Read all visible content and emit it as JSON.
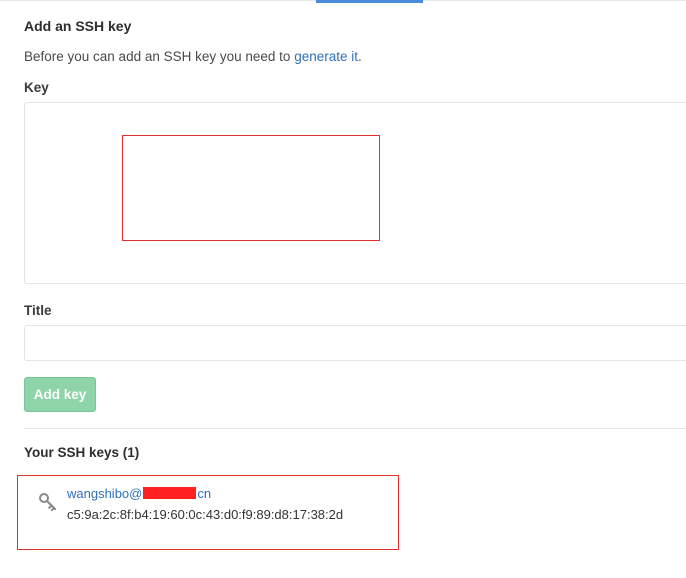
{
  "page": {
    "heading": "Add an SSH key",
    "intro": {
      "prefix": "Before you can add an SSH key you need to ",
      "link": "generate it",
      "suffix": "."
    }
  },
  "form": {
    "key_label": "Key",
    "key_value": "",
    "title_label": "Title",
    "title_value": "",
    "submit_label": "Add key"
  },
  "ssh_keys": {
    "heading": "Your SSH keys (1)",
    "items": [
      {
        "title_prefix": "wangshibo@",
        "title_suffix": "cn",
        "fingerprint": "c5:9a:2c:8f:b4:19:60:0c:43:d0:f9:89:d8:17:38:2d",
        "icon": "key-icon"
      }
    ]
  },
  "colors": {
    "link": "#2f70b8",
    "button_bg": "#8fd3a8",
    "active_tab": "#4a8bdb",
    "annotation": "#e03030"
  }
}
